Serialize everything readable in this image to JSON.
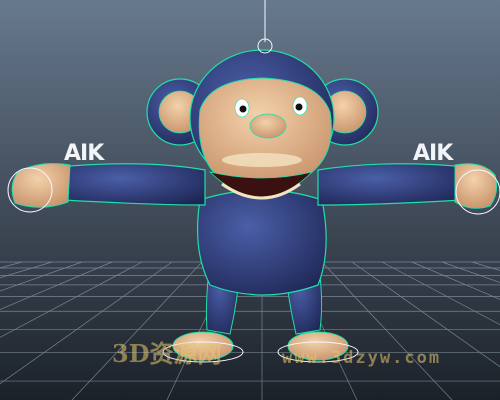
{
  "viewport": {
    "background_top": "#67798d",
    "background_bottom": "#1c2129",
    "grid_color": "#8fa0b0",
    "wireframe_color": "#1fe0a8",
    "selection_color": "#f4f6ff"
  },
  "character": {
    "fur_color": "#2c3a78",
    "face_color": "#d9a77f",
    "highlight_color": "#f4e3c0"
  },
  "rig_labels": {
    "left_ik": "AIK",
    "right_ik": "AIK"
  },
  "watermark": {
    "site_name": "3D资源网",
    "url": "www.3dzyw.com"
  }
}
